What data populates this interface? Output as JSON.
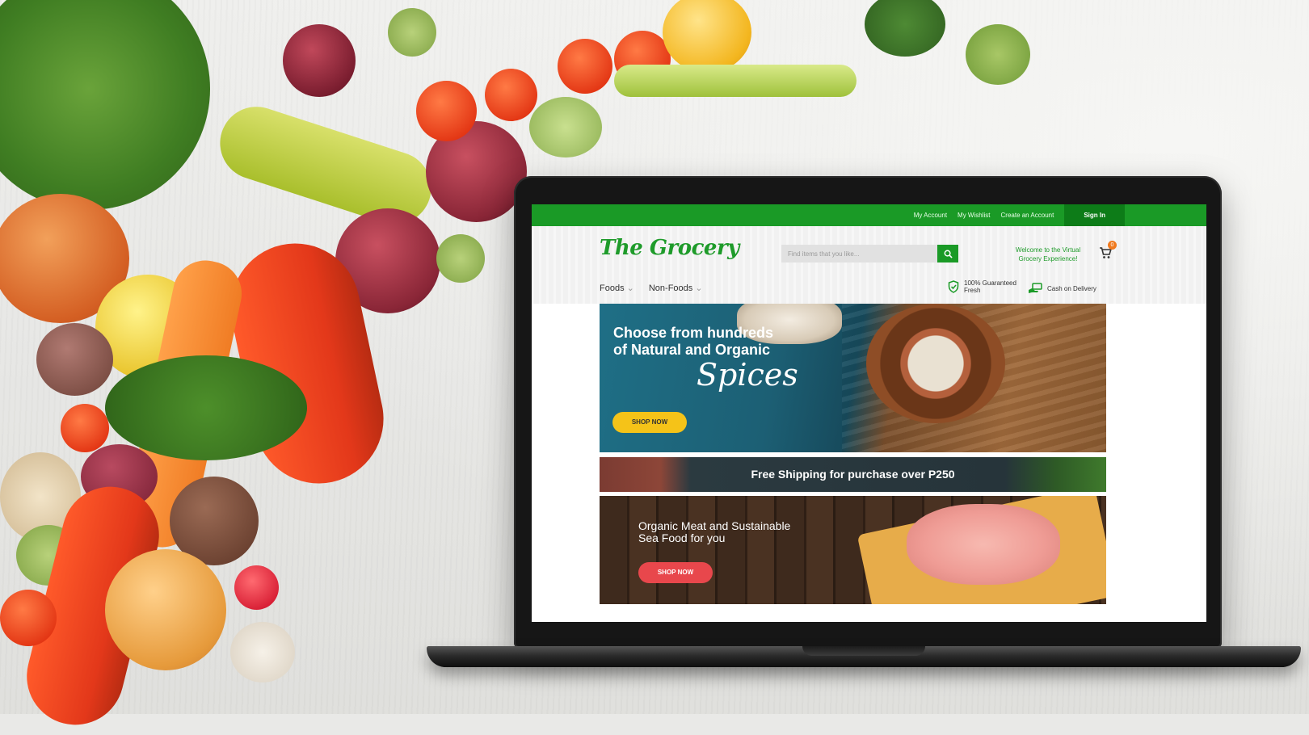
{
  "topbar": {
    "links": [
      "My Account",
      "My Wishlist",
      "Create an Account"
    ],
    "signin": "Sign In"
  },
  "header": {
    "logo": "The Grocery",
    "search_placeholder": "Find items that you like...",
    "welcome": "Welcome to the Virtual Grocery Experience!",
    "cart_count": "0"
  },
  "nav": {
    "items": [
      "Foods",
      "Non-Foods"
    ]
  },
  "features": {
    "fresh": "100% Guaranteed Fresh",
    "cod": "Cash on Delivery"
  },
  "banners": {
    "spices_heading": "Choose from hundreds of Natural and Organic",
    "spices_script": "Spices",
    "spices_button": "SHOP NOW",
    "shipping": "Free Shipping for purchase over P250",
    "meat_heading": "Organic Meat and Sustainable Sea Food for you",
    "meat_button": "SHOP NOW"
  },
  "colors": {
    "brand_green": "#1a9a26",
    "accent_yellow": "#f5c318",
    "accent_red": "#e8474c",
    "cart_badge": "#f07a1f"
  }
}
